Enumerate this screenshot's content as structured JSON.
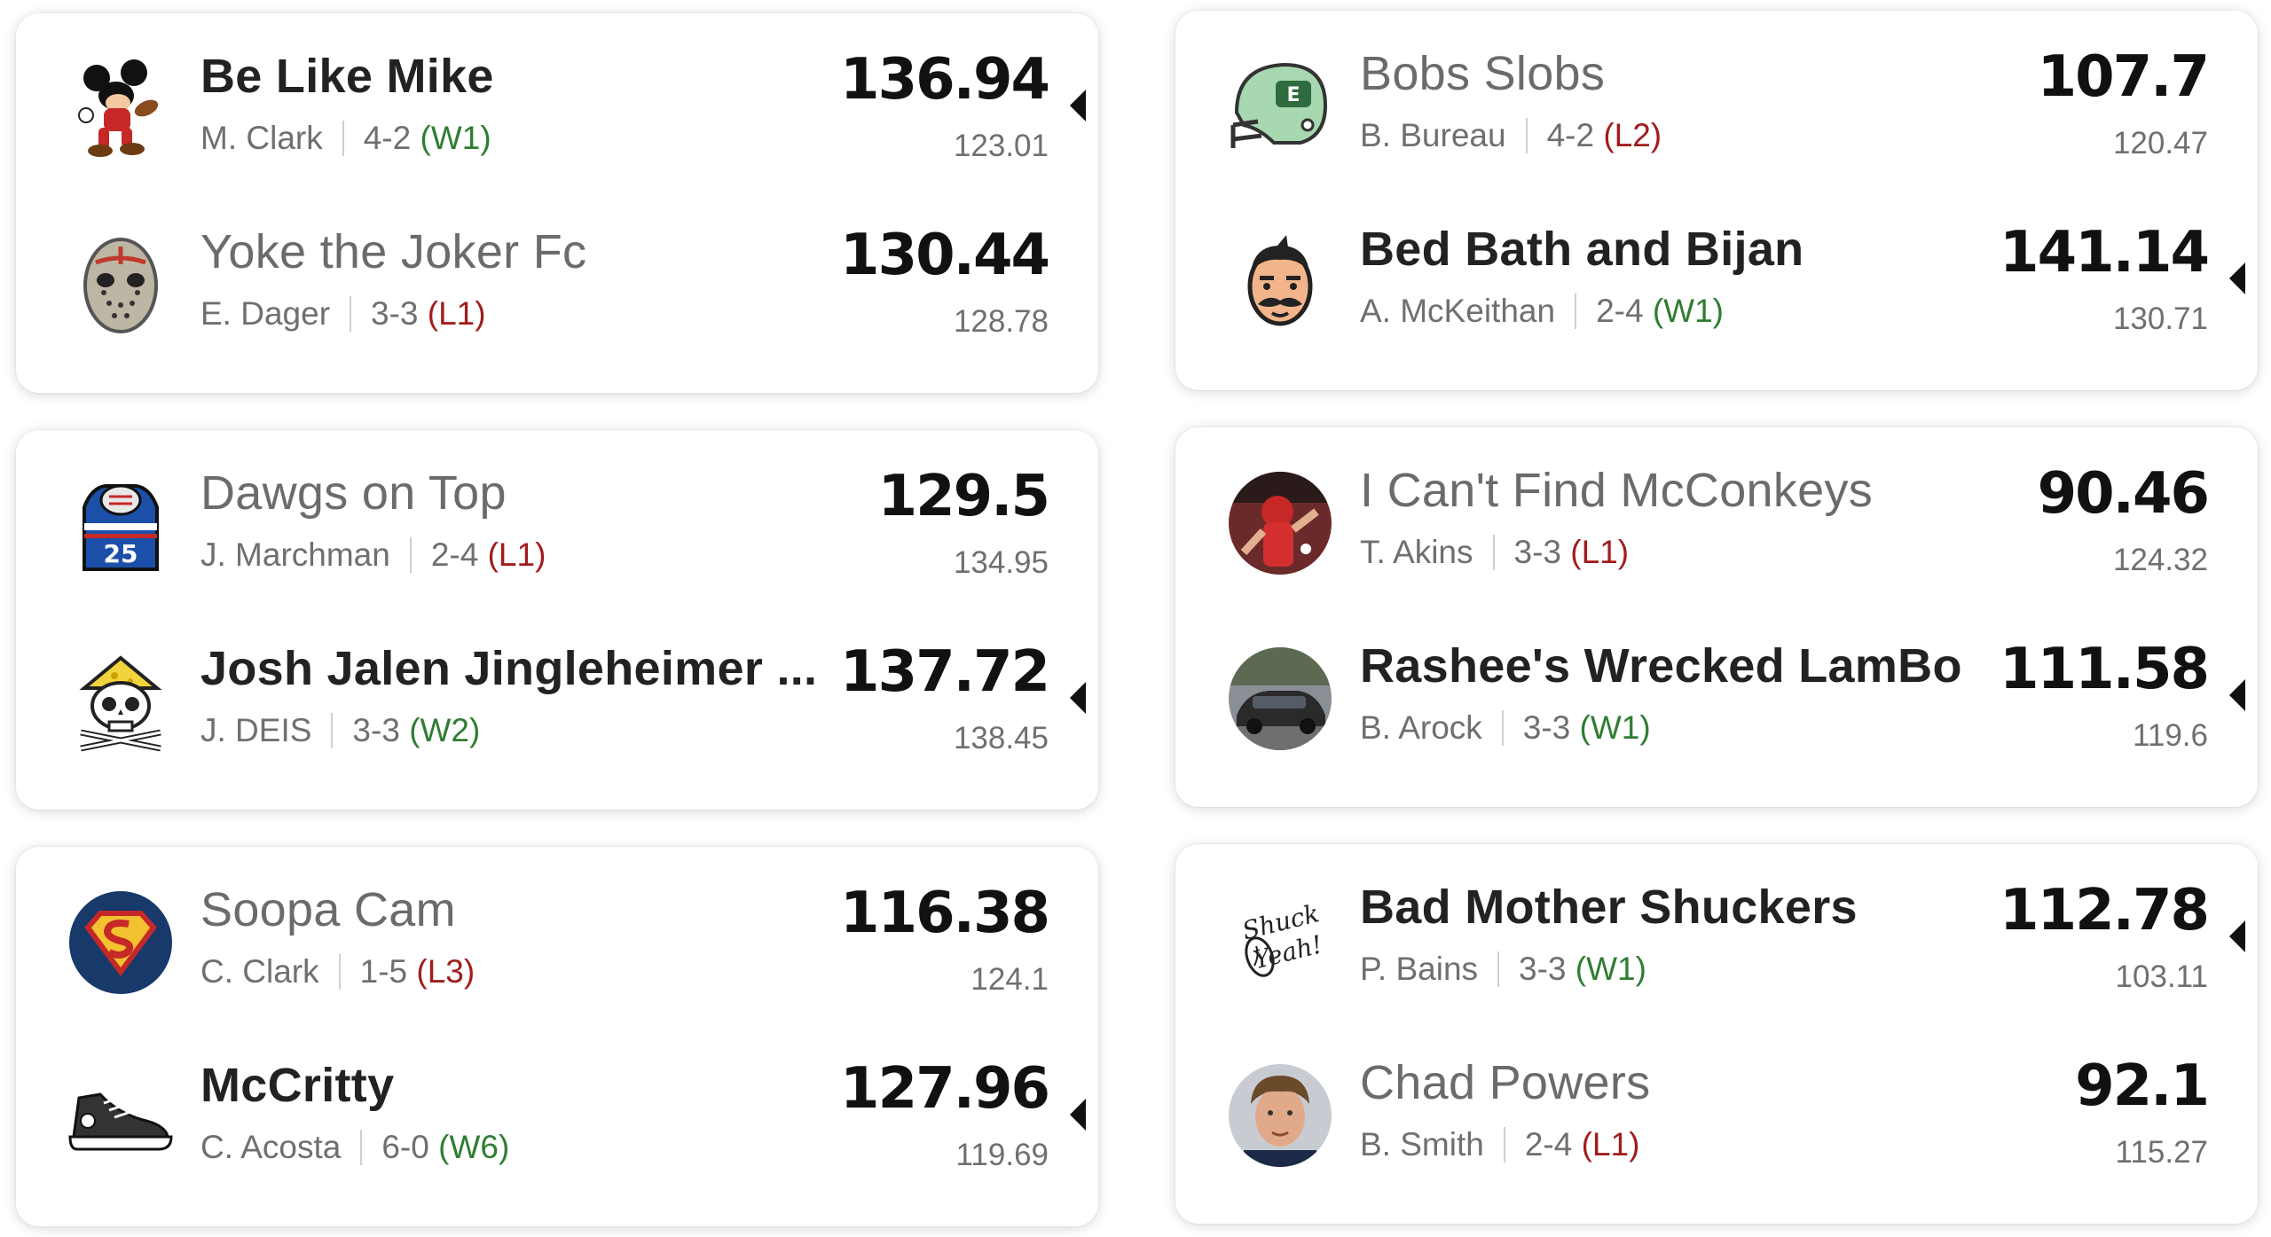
{
  "colors": {
    "win": "#2f7d33",
    "loss": "#a31c1c",
    "text_primary": "#222222",
    "text_secondary": "#6f6f6f"
  },
  "matchups": [
    {
      "team1": {
        "name": "Be Like Mike",
        "owner": "M. Clark",
        "record": "4-2",
        "streak": "(W1)",
        "score": "136.94",
        "projected": "123.01",
        "logo_icon": "mickey-mouse-football-icon",
        "winner": true
      },
      "team2": {
        "name": "Yoke the Joker Fc",
        "owner": "E. Dager",
        "record": "3-3",
        "streak": "(L1)",
        "score": "130.44",
        "projected": "128.78",
        "logo_icon": "hockey-mask-icon",
        "winner": false
      }
    },
    {
      "team1": {
        "name": "Bobs Slobs",
        "owner": "B. Bureau",
        "record": "4-2",
        "streak": "(L2)",
        "score": "107.7",
        "projected": "120.47",
        "logo_icon": "green-helmet-icon",
        "winner": false
      },
      "team2": {
        "name": "Bed Bath and Bijan",
        "owner": "A. McKeithan",
        "record": "2-4",
        "streak": "(W1)",
        "score": "141.14",
        "projected": "130.71",
        "logo_icon": "mustache-face-icon",
        "winner": true
      }
    },
    {
      "team1": {
        "name": "Dawgs on Top",
        "owner": "J. Marchman",
        "record": "2-4",
        "streak": "(L1)",
        "score": "129.5",
        "projected": "134.95",
        "logo_icon": "jersey-25-icon",
        "winner": false
      },
      "team2": {
        "name": "Josh Jalen Jingleheimer ...",
        "owner": "J. DEIS",
        "record": "3-3",
        "streak": "(W2)",
        "score": "137.72",
        "projected": "138.45",
        "logo_icon": "cheese-skull-icon",
        "winner": true
      }
    },
    {
      "team1": {
        "name": "I Can't Find McConkeys",
        "owner": "T. Akins",
        "record": "3-3",
        "streak": "(L1)",
        "score": "90.46",
        "projected": "124.32",
        "logo_icon": "player-photo-icon",
        "winner": false
      },
      "team2": {
        "name": "Rashee's Wrecked LamBo",
        "owner": "B. Arock",
        "record": "3-3",
        "streak": "(W1)",
        "score": "111.58",
        "projected": "119.6",
        "logo_icon": "car-photo-icon",
        "winner": true
      }
    },
    {
      "team1": {
        "name": "Soopa Cam",
        "owner": "C. Clark",
        "record": "1-5",
        "streak": "(L3)",
        "score": "116.38",
        "projected": "124.1",
        "logo_icon": "superman-shield-icon",
        "winner": false
      },
      "team2": {
        "name": "McCritty",
        "owner": "C. Acosta",
        "record": "6-0",
        "streak": "(W6)",
        "score": "127.96",
        "projected": "119.69",
        "logo_icon": "sneaker-icon",
        "winner": true
      }
    },
    {
      "team1": {
        "name": "Bad Mother Shuckers",
        "owner": "P. Bains",
        "record": "3-3",
        "streak": "(W1)",
        "score": "112.78",
        "projected": "103.11",
        "logo_icon": "shuck-yeah-script-icon",
        "logo_text": "Shuck Yeah!",
        "winner": true
      },
      "team2": {
        "name": "Chad Powers",
        "owner": "B. Smith",
        "record": "2-4",
        "streak": "(L1)",
        "score": "92.1",
        "projected": "115.27",
        "logo_icon": "player-face-photo-icon",
        "winner": false
      }
    }
  ]
}
